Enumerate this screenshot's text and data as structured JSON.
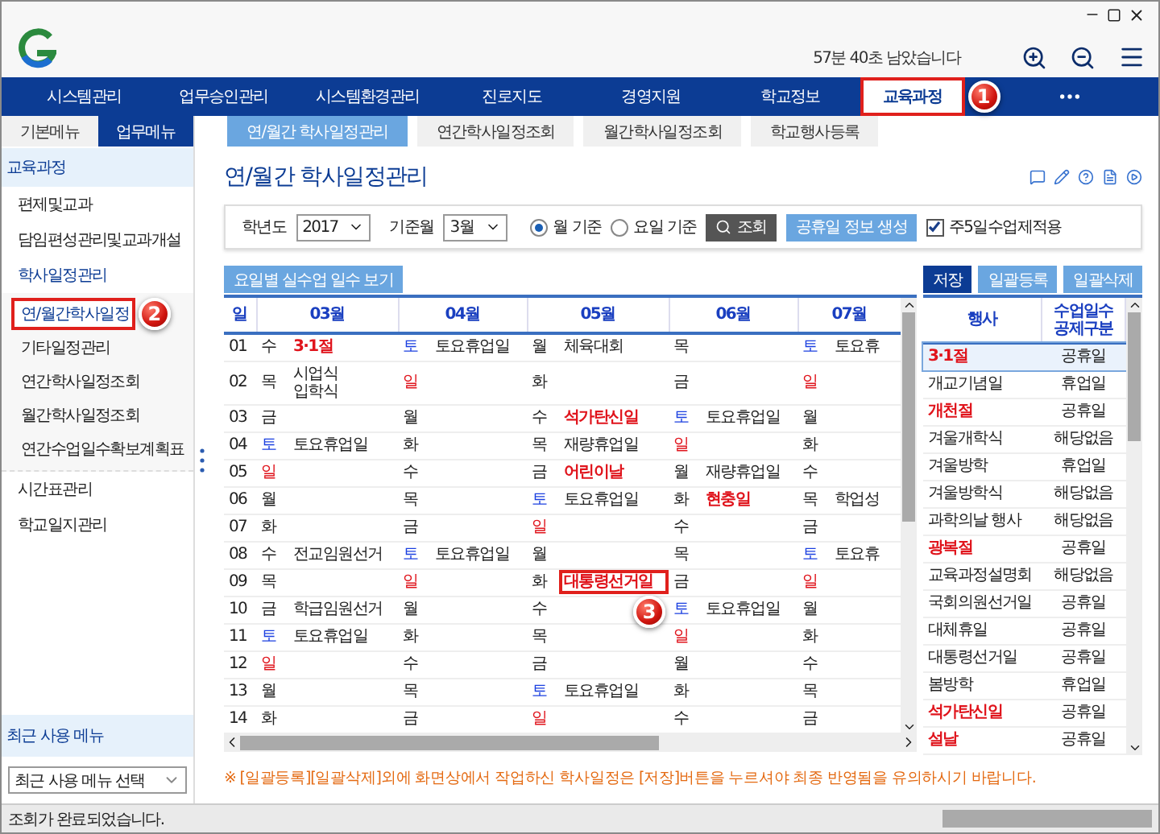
{
  "window": {
    "session_notice": "57분 40초 남았습니다"
  },
  "nav": {
    "items": [
      {
        "label": "시스템관리",
        "selected": false
      },
      {
        "label": "업무승인관리",
        "selected": false
      },
      {
        "label": "시스템환경관리",
        "selected": false
      },
      {
        "label": "진로지도",
        "selected": false
      },
      {
        "label": "경영지원",
        "selected": false
      },
      {
        "label": "학교정보",
        "selected": false
      },
      {
        "label": "교육과정",
        "selected": true,
        "callout": "1"
      }
    ]
  },
  "sidebar": {
    "tabs": [
      {
        "label": "기본메뉴",
        "selected": false
      },
      {
        "label": "업무메뉴",
        "selected": true
      }
    ],
    "section": "교육과정",
    "items": [
      {
        "label": "편제및교과",
        "selected": false
      },
      {
        "label": "담임편성관리및교과개설",
        "selected": false
      },
      {
        "label": "학사일정관리",
        "selected": false,
        "expanded": true,
        "children": [
          {
            "label": "연/월간학사일정",
            "selected": true,
            "callout": "2"
          },
          {
            "label": "기타일정관리",
            "selected": false
          },
          {
            "label": "연간학사일정조회",
            "selected": false
          },
          {
            "label": "월간학사일정조회",
            "selected": false
          },
          {
            "label": "연간수업일수확보계획표",
            "selected": false
          }
        ]
      },
      {
        "label": "시간표관리",
        "selected": false
      },
      {
        "label": "학교일지관리",
        "selected": false
      }
    ],
    "recent_title": "최근 사용 메뉴",
    "recent_select": "최근 사용 메뉴 선택"
  },
  "content_tabs": [
    {
      "label": "연/월간 학사일정관리",
      "selected": true
    },
    {
      "label": "연간학사일정조회",
      "selected": false
    },
    {
      "label": "월간학사일정조회",
      "selected": false
    },
    {
      "label": "학교행사등록",
      "selected": false
    }
  ],
  "page_title": "연/월간 학사일정관리",
  "filters": {
    "year_label": "학년도",
    "year": "2017",
    "month_label": "기준월",
    "month": "3월",
    "radios": [
      {
        "label": "월 기준",
        "selected": true
      },
      {
        "label": "요일 기준",
        "selected": false
      }
    ],
    "search_button": "조회",
    "holiday_button": "공휴일 정보 생성",
    "checkbox": {
      "label": "주5일수업제적용",
      "checked": true
    }
  },
  "grid": {
    "view_button": "요일별 실수업 일수 보기",
    "day_header": "일",
    "months": [
      "03월",
      "04월",
      "05월",
      "06월",
      "07월"
    ],
    "rows": [
      {
        "day": "01",
        "cells": [
          {
            "weekday": "수",
            "kind": "weekday",
            "event": "3·1절",
            "holiday": true
          },
          {
            "weekday": "토",
            "kind": "sat",
            "event": "토요휴업일",
            "holiday": false
          },
          {
            "weekday": "월",
            "kind": "weekday",
            "event": "체육대회",
            "holiday": false
          },
          {
            "weekday": "목",
            "kind": "weekday"
          },
          {
            "weekday": "토",
            "kind": "sat",
            "event": "토요휴",
            "holiday": false
          }
        ]
      },
      {
        "day": "02",
        "cells": [
          {
            "weekday": "목",
            "kind": "weekday",
            "event": "시업식\n입학식",
            "holiday": false
          },
          {
            "weekday": "일",
            "kind": "sun"
          },
          {
            "weekday": "화",
            "kind": "weekday"
          },
          {
            "weekday": "금",
            "kind": "weekday"
          },
          {
            "weekday": "일",
            "kind": "sun"
          }
        ]
      },
      {
        "day": "03",
        "cells": [
          {
            "weekday": "금",
            "kind": "weekday"
          },
          {
            "weekday": "월",
            "kind": "weekday"
          },
          {
            "weekday": "수",
            "kind": "weekday",
            "event": "석가탄신일",
            "holiday": true
          },
          {
            "weekday": "토",
            "kind": "sat",
            "event": "토요휴업일",
            "holiday": false
          },
          {
            "weekday": "월",
            "kind": "weekday"
          }
        ]
      },
      {
        "day": "04",
        "cells": [
          {
            "weekday": "토",
            "kind": "sat",
            "event": "토요휴업일",
            "holiday": false
          },
          {
            "weekday": "화",
            "kind": "weekday"
          },
          {
            "weekday": "목",
            "kind": "weekday",
            "event": "재량휴업일",
            "holiday": false
          },
          {
            "weekday": "일",
            "kind": "sun"
          },
          {
            "weekday": "화",
            "kind": "weekday"
          }
        ]
      },
      {
        "day": "05",
        "cells": [
          {
            "weekday": "일",
            "kind": "sun"
          },
          {
            "weekday": "수",
            "kind": "weekday"
          },
          {
            "weekday": "금",
            "kind": "weekday",
            "event": "어린이날",
            "holiday": true
          },
          {
            "weekday": "월",
            "kind": "weekday",
            "event": "재량휴업일",
            "holiday": false
          },
          {
            "weekday": "수",
            "kind": "weekday"
          }
        ]
      },
      {
        "day": "06",
        "cells": [
          {
            "weekday": "월",
            "kind": "weekday"
          },
          {
            "weekday": "목",
            "kind": "weekday"
          },
          {
            "weekday": "토",
            "kind": "sat",
            "event": "토요휴업일",
            "holiday": false
          },
          {
            "weekday": "화",
            "kind": "weekday",
            "event": "현충일",
            "holiday": true
          },
          {
            "weekday": "목",
            "kind": "weekday",
            "event": "학업성",
            "holiday": false
          }
        ]
      },
      {
        "day": "07",
        "cells": [
          {
            "weekday": "화",
            "kind": "weekday"
          },
          {
            "weekday": "금",
            "kind": "weekday"
          },
          {
            "weekday": "일",
            "kind": "sun"
          },
          {
            "weekday": "수",
            "kind": "weekday"
          },
          {
            "weekday": "금",
            "kind": "weekday"
          }
        ]
      },
      {
        "day": "08",
        "cells": [
          {
            "weekday": "수",
            "kind": "weekday",
            "event": "전교임원선거",
            "holiday": false
          },
          {
            "weekday": "토",
            "kind": "sat",
            "event": "토요휴업일",
            "holiday": false
          },
          {
            "weekday": "월",
            "kind": "weekday"
          },
          {
            "weekday": "목",
            "kind": "weekday"
          },
          {
            "weekday": "토",
            "kind": "sat",
            "event": "토요휴",
            "holiday": false
          }
        ]
      },
      {
        "day": "09",
        "cells": [
          {
            "weekday": "목",
            "kind": "weekday"
          },
          {
            "weekday": "일",
            "kind": "sun"
          },
          {
            "weekday": "화",
            "kind": "weekday",
            "event": "대통령선거일",
            "holiday": true,
            "callout": "3"
          },
          {
            "weekday": "금",
            "kind": "weekday"
          },
          {
            "weekday": "일",
            "kind": "sun"
          }
        ]
      },
      {
        "day": "10",
        "cells": [
          {
            "weekday": "금",
            "kind": "weekday",
            "event": "학급임원선거",
            "holiday": false
          },
          {
            "weekday": "월",
            "kind": "weekday"
          },
          {
            "weekday": "수",
            "kind": "weekday"
          },
          {
            "weekday": "토",
            "kind": "sat",
            "event": "토요휴업일",
            "holiday": false
          },
          {
            "weekday": "월",
            "kind": "weekday"
          }
        ]
      },
      {
        "day": "11",
        "cells": [
          {
            "weekday": "토",
            "kind": "sat",
            "event": "토요휴업일",
            "holiday": false
          },
          {
            "weekday": "화",
            "kind": "weekday"
          },
          {
            "weekday": "목",
            "kind": "weekday"
          },
          {
            "weekday": "일",
            "kind": "sun"
          },
          {
            "weekday": "화",
            "kind": "weekday"
          }
        ]
      },
      {
        "day": "12",
        "cells": [
          {
            "weekday": "일",
            "kind": "sun"
          },
          {
            "weekday": "수",
            "kind": "weekday"
          },
          {
            "weekday": "금",
            "kind": "weekday"
          },
          {
            "weekday": "월",
            "kind": "weekday"
          },
          {
            "weekday": "수",
            "kind": "weekday"
          }
        ]
      },
      {
        "day": "13",
        "cells": [
          {
            "weekday": "월",
            "kind": "weekday"
          },
          {
            "weekday": "목",
            "kind": "weekday"
          },
          {
            "weekday": "토",
            "kind": "sat",
            "event": "토요휴업일",
            "holiday": false
          },
          {
            "weekday": "화",
            "kind": "weekday"
          },
          {
            "weekday": "목",
            "kind": "weekday"
          }
        ]
      },
      {
        "day": "14",
        "cells": [
          {
            "weekday": "화",
            "kind": "weekday"
          },
          {
            "weekday": "금",
            "kind": "weekday"
          },
          {
            "weekday": "일",
            "kind": "sun"
          },
          {
            "weekday": "수",
            "kind": "weekday"
          },
          {
            "weekday": "금",
            "kind": "weekday"
          }
        ]
      }
    ]
  },
  "events": {
    "buttons": [
      {
        "label": "저장",
        "primary": true
      },
      {
        "label": "일괄등록",
        "primary": false
      },
      {
        "label": "일괄삭제",
        "primary": false
      }
    ],
    "columns": [
      "행사",
      "수업일수\n공제구분"
    ],
    "rows": [
      {
        "name": "3·1절",
        "type": "공휴일",
        "holiday": true,
        "selected": true
      },
      {
        "name": "개교기념일",
        "type": "휴업일",
        "holiday": false,
        "selected": false
      },
      {
        "name": "개천절",
        "type": "공휴일",
        "holiday": true,
        "selected": false
      },
      {
        "name": "겨울개학식",
        "type": "해당없음",
        "holiday": false,
        "selected": false
      },
      {
        "name": "겨울방학",
        "type": "휴업일",
        "holiday": false,
        "selected": false
      },
      {
        "name": "겨울방학식",
        "type": "해당없음",
        "holiday": false,
        "selected": false
      },
      {
        "name": "과학의날 행사",
        "type": "해당없음",
        "holiday": false,
        "selected": false
      },
      {
        "name": "광복절",
        "type": "공휴일",
        "holiday": true,
        "selected": false
      },
      {
        "name": "교육과정설명회",
        "type": "해당없음",
        "holiday": false,
        "selected": false
      },
      {
        "name": "국회의원선거일",
        "type": "공휴일",
        "holiday": false,
        "selected": false
      },
      {
        "name": "대체휴일",
        "type": "공휴일",
        "holiday": false,
        "selected": false
      },
      {
        "name": "대통령선거일",
        "type": "공휴일",
        "holiday": false,
        "selected": false
      },
      {
        "name": "봄방학",
        "type": "휴업일",
        "holiday": false,
        "selected": false
      },
      {
        "name": "석가탄신일",
        "type": "공휴일",
        "holiday": true,
        "selected": false
      },
      {
        "name": "설날",
        "type": "공휴일",
        "holiday": true,
        "selected": false
      }
    ]
  },
  "note": "※ [일괄등록][일괄삭제]외에 화면상에서 작업하신 학사일정은 [저장]버튼을 누르셔야 최종 반영됨을 유의하시기 바랍니다.",
  "status_bar": "조회가 완료되었습니다."
}
